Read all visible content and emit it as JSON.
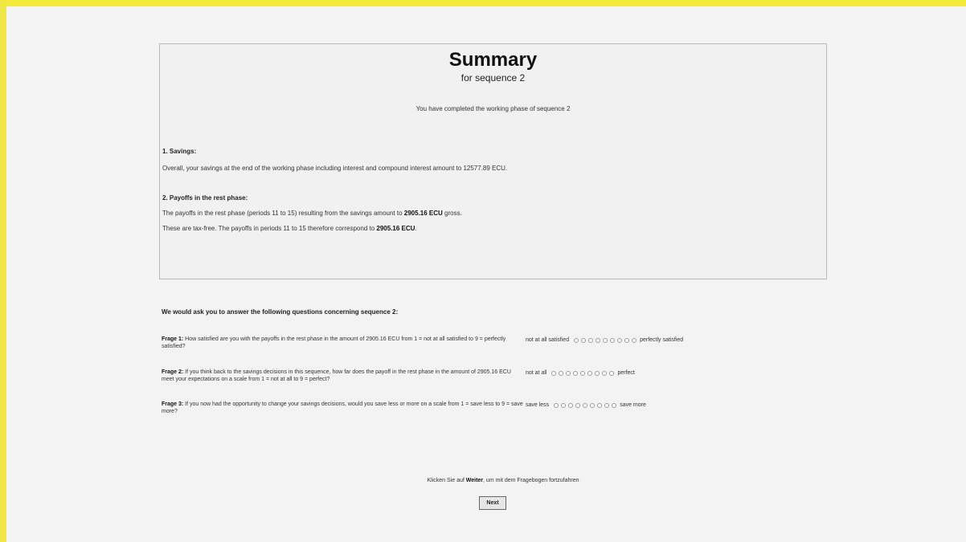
{
  "summary": {
    "title": "Summary",
    "subtitle": "for sequence 2",
    "completed": "You have completed the working phase of sequence 2",
    "savings": {
      "heading": "1. Savings:",
      "text": "Overall, your savings at the end of the working phase including interest and compound interest amount to 12577.89 ECU."
    },
    "payoffs": {
      "heading": "2. Payoffs in the rest phase:",
      "line1_prefix": "The payoffs in the rest phase (periods 11 to 15) resulting from the savings amount to ",
      "line1_value": "2905.16 ECU",
      "line1_suffix": " gross.",
      "line2_prefix": "These are tax-free. The payoffs in periods 11 to 15 therefore correspond to ",
      "line2_value": "2905.16 ECU",
      "line2_suffix": "."
    }
  },
  "questions": {
    "title": "We would ask you to answer the following questions concerning sequence 2:",
    "items": [
      {
        "label": "Frage 1:",
        "text": " How satisfied are you with the payoffs in the rest phase in the amount of 2905.16 ECU from 1 = not at all satisfied to 9 = perfectly satisfied?",
        "low": "not at all satisfied",
        "high": "perfectly satisfied",
        "options": 9
      },
      {
        "label": "Frage 2:",
        "text": " If you think back to the savings decisions in this sequence, how far does the payoff in the rest phase in the amount of 2905.16 ECU meet your expectations on a scale from 1 = not at all to 9 = perfect?",
        "low": "not at all",
        "high": "perfect",
        "options": 9
      },
      {
        "label": "Frage 3:",
        "text": " If you now had the opportunity to change your savings decisions, would you save less or more on a scale from 1 = save less to 9 = save more?",
        "low": "save less",
        "high": "save more",
        "options": 9
      }
    ]
  },
  "footer": {
    "hint_prefix": "Klicken Sie auf ",
    "hint_bold": "Weiter",
    "hint_suffix": ", um mit dem Fragebogen fortzufahren",
    "next_label": "Next"
  }
}
